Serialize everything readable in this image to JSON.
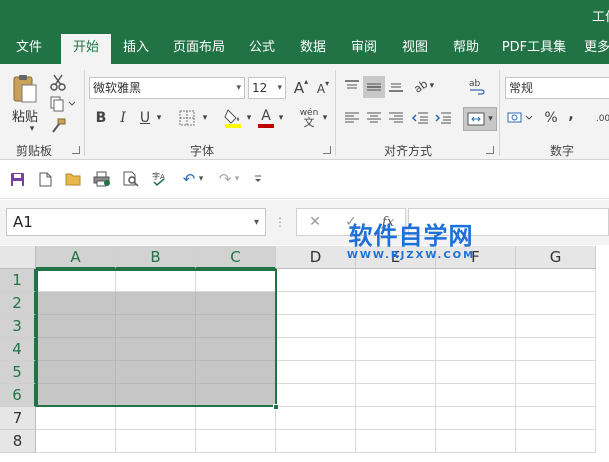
{
  "window": {
    "title": "工作"
  },
  "tabs": [
    {
      "label": "文件"
    },
    {
      "label": "开始",
      "active": true
    },
    {
      "label": "插入"
    },
    {
      "label": "页面布局"
    },
    {
      "label": "公式"
    },
    {
      "label": "数据"
    },
    {
      "label": "审阅"
    },
    {
      "label": "视图"
    },
    {
      "label": "帮助"
    },
    {
      "label": "PDF工具集"
    },
    {
      "label": "更多"
    }
  ],
  "ribbon": {
    "clipboard": {
      "label": "剪贴板",
      "paste_label": "粘贴"
    },
    "font": {
      "label": "字体",
      "font_name": "微软雅黑",
      "font_size": "12",
      "grow_label": "A",
      "shrink_label": "A",
      "bold_label": "B",
      "italic_label": "I",
      "underline_label": "U",
      "fill_color": "#ffff00",
      "font_color": "#c00000",
      "phonetic_label": "wén",
      "font_a_label": "A"
    },
    "alignment": {
      "label": "对齐方式",
      "rotate_label": "ab"
    },
    "number": {
      "label": "数字",
      "format": "常规",
      "percent_label": "%",
      "comma_label": ",",
      "decimal_label": ".00"
    }
  },
  "quick_access": {
    "icons": [
      "save-icon",
      "new-icon",
      "open-icon",
      "quick-print-icon",
      "print-preview-icon",
      "spelling-icon",
      "undo-icon",
      "redo-icon",
      "customize-icon"
    ]
  },
  "formula_bar": {
    "name_box": "A1",
    "fx_label": "fx",
    "formula": ""
  },
  "watermark": {
    "text": "软件自学网",
    "url": "WWW.RJZXW.COM"
  },
  "grid": {
    "columns": [
      "A",
      "B",
      "C",
      "D",
      "E",
      "F",
      "G"
    ],
    "rows": [
      "1",
      "2",
      "3",
      "4",
      "5",
      "6",
      "7",
      "8"
    ],
    "selected_range": "A1:C6",
    "shaded_range": "A2:C6"
  },
  "colors": {
    "accent": "#217346",
    "shade": "#c6c6c6",
    "watermark": "#1e6fd9"
  }
}
